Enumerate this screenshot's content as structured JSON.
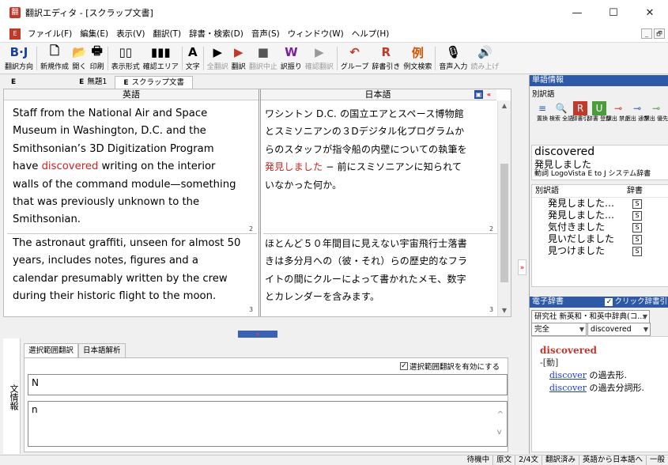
{
  "window": {
    "app_icon": "翻",
    "title": "翻訳エディタ - [スクラップ文書]",
    "controls": [
      "—",
      "☐",
      "✕"
    ]
  },
  "menubar": {
    "icon": "E",
    "items": [
      "ファイル(F)",
      "編集(E)",
      "表示(V)",
      "翻訳(T)",
      "辞書・検索(D)",
      "音声(S)",
      "ウィンドウ(W)",
      "ヘルプ(H)"
    ],
    "mdi_buttons": [
      "_",
      "🗗"
    ]
  },
  "toolbar": {
    "items": [
      {
        "icon": "B·J",
        "label": "翻訳方向",
        "disabled": false
      },
      {
        "icon": "🗋",
        "label": "新規作成",
        "disabled": false
      },
      {
        "icon": "📂",
        "label": "開く",
        "disabled": false
      },
      {
        "icon": "🖶",
        "label": "印刷",
        "disabled": false
      },
      {
        "icon": "▯▯",
        "label": "表示形式",
        "disabled": false
      },
      {
        "icon": "▮▮▮",
        "label": "確認エリア",
        "disabled": false
      },
      {
        "icon": "A",
        "label": "文字",
        "disabled": false
      },
      {
        "icon": "▶",
        "label": "全翻訳",
        "disabled": true
      },
      {
        "icon": "▶",
        "label": "翻訳",
        "disabled": false
      },
      {
        "icon": "■",
        "label": "翻訳中止",
        "disabled": true
      },
      {
        "icon": "W",
        "label": "訳振り",
        "disabled": false
      },
      {
        "icon": "▶",
        "label": "確認翻訳",
        "disabled": true
      },
      {
        "icon": "↶",
        "label": "グループ",
        "disabled": false
      },
      {
        "icon": "R",
        "label": "辞書引き",
        "disabled": false
      },
      {
        "icon": "例",
        "label": "例文検索",
        "disabled": false
      },
      {
        "icon": "🎙",
        "label": "音声入力",
        "disabled": false
      },
      {
        "icon": "🔊",
        "label": "読み上げ",
        "disabled": true
      }
    ]
  },
  "tabs": [
    {
      "prefix": "E",
      "label": "",
      "active": false
    },
    {
      "prefix": "E",
      "label": "無題1",
      "active": false
    },
    {
      "prefix": "E",
      "label": "スクラップ文書",
      "active": true
    }
  ],
  "editor": {
    "col_en": "英語",
    "col_ja": "日本語",
    "segments": [
      {
        "en_lines": [
          "Staff from the National Air and Space",
          "Museum in Washington, D.C. and the",
          "Smithsonian’s 3D Digitization Program",
          "",
          "walls of the command module—something",
          "that was previously unknown to the",
          "Smithsonian."
        ],
        "en_line4_before": "have ",
        "en_line4_hl": "discovered",
        "en_line4_after": " writing on the interior",
        "ja_line1": "ワシントン D.C. の国立エアとスペース博物館",
        "ja_line2": "とスミソニアンの３Dデジタル化プログラムか",
        "ja_line3": "らのスタッフが指令船の内壁についての執筆を",
        "ja_line4_hl": "発見しました",
        "ja_line4_rest": " − 前にスミソニアンに知られて",
        "ja_line5": "いなかった何か。",
        "num": "2"
      },
      {
        "en_lines": [
          "The astronaut graffiti, unseen for almost 50",
          "years, includes notes, figures and a",
          "calendar presumably written by the crew",
          "during their historic flight to the moon."
        ],
        "ja_lines": [
          "ほとんど５０年間目に見えない宇宙飛行士落書",
          "きは多分月への（彼・それ）らの歴史的なフラ",
          "イトの間にクルーによって書かれたメモ、数字",
          "とカレンダーを含みます。"
        ],
        "num": "3"
      }
    ],
    "splitter_glyph": "»"
  },
  "bottom": {
    "side_label": "文情報",
    "tabs": [
      "選択範囲翻訳",
      "日本語解析"
    ],
    "checkbox_label": "選択範囲翻訳を有効にする",
    "field1": "N",
    "field2": "n"
  },
  "right_panel": {
    "title": "単語情報",
    "subtitle": "別訳語",
    "icons": [
      {
        "g": "≡",
        "t": "置換"
      },
      {
        "g": "🔍",
        "t": "検索 全語"
      },
      {
        "g": "R",
        "t": "辞書引"
      },
      {
        "g": "U",
        "t": "辞書 登録"
      },
      {
        "g": "⊸",
        "t": "訳出 禁止"
      },
      {
        "g": "⊸",
        "t": "訳出 通常"
      },
      {
        "g": "⊸",
        "t": "訳出 優先"
      }
    ],
    "word": "discovered",
    "word_ja": "発見しました",
    "word_pos": "動詞 LogoVista E to J システム辞書",
    "list_head_word": "別訳語",
    "list_head_dict": "辞書",
    "list_items": [
      "発見しました…",
      "発見しました…",
      "気付きました",
      "見いだしました",
      "見つけました"
    ],
    "list_dict_mark": "S",
    "collapse_glyph": "»",
    "edict_title": "電子辞書",
    "edict_checkbox": "クリック辞書引",
    "edict_dict": "研究社 新英和・和英中辞典(コ...",
    "edict_mode": "完全",
    "edict_query": "discovered",
    "def_head": "discovered",
    "def_pos": "-[動]",
    "def_lines": [
      {
        "link": "discover",
        "rest": " の過去形."
      },
      {
        "link": "discover",
        "rest": " の過去分詞形."
      }
    ]
  },
  "status": [
    "待機中",
    "原文",
    "2/4文",
    "翻訳済み",
    "英語から日本語へ",
    "一般"
  ]
}
